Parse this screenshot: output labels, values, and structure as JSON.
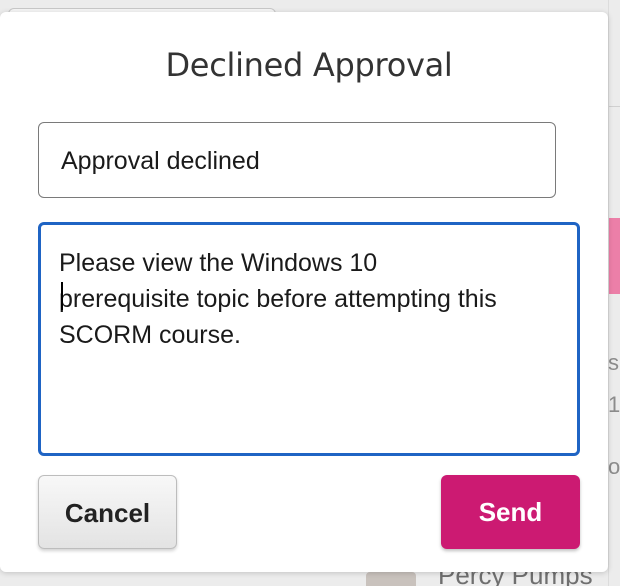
{
  "dialog": {
    "title": "Declined Approval",
    "subject_value": "Approval declined",
    "message_value": "Please view the Windows 10\nprerequisite topic before attempting this\nSCORM course.",
    "cancel_label": "Cancel",
    "send_label": "Send"
  },
  "colors": {
    "send_button": "#cc1a72",
    "focus_border": "#1f64c4"
  },
  "background": {
    "fragments": [
      "s",
      "1",
      "or"
    ],
    "partial_name": "Percy Pumps"
  }
}
